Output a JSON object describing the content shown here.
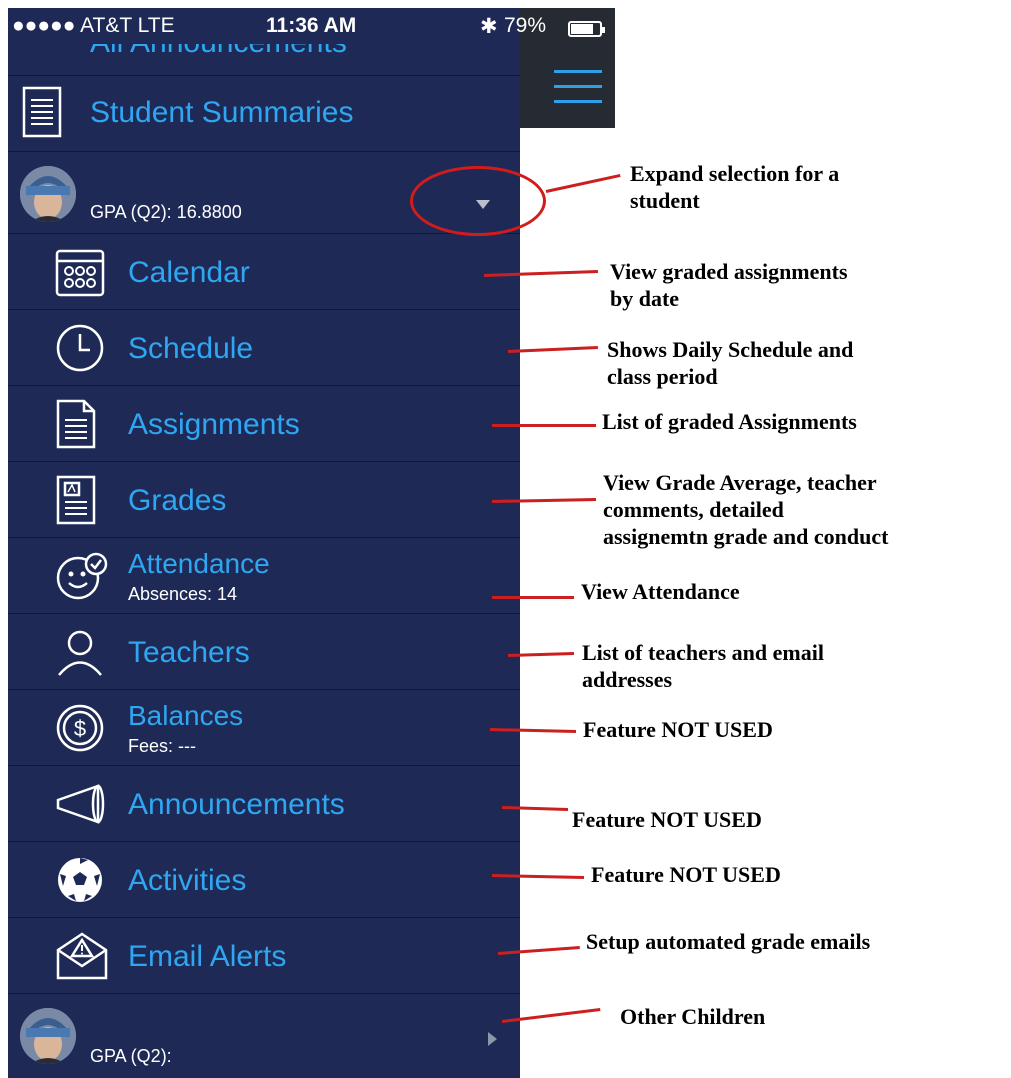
{
  "status_bar": {
    "carrier": "●●●●● AT&T  LTE",
    "time": "11:36 AM",
    "bluetooth": "✱",
    "battery": "79%",
    "battery_level": 0.79
  },
  "top_items": {
    "partial_label": "All Announcements",
    "student_summaries": "Student Summaries"
  },
  "student": {
    "gpa": "GPA (Q2): 16.8800"
  },
  "menu_items": [
    {
      "label": "Calendar",
      "icon": "calendar-icon"
    },
    {
      "label": "Schedule",
      "icon": "clock-icon"
    },
    {
      "label": "Assignments",
      "icon": "document-icon"
    },
    {
      "label": "Grades",
      "icon": "grades-document-icon"
    },
    {
      "label": "Attendance",
      "sub": "Absences: 14",
      "icon": "smiley-check-icon"
    },
    {
      "label": "Teachers",
      "icon": "person-icon"
    },
    {
      "label": "Balances",
      "sub": "Fees: ---",
      "icon": "dollar-coin-icon"
    },
    {
      "label": "Announcements",
      "icon": "megaphone-icon"
    },
    {
      "label": "Activities",
      "icon": "soccer-ball-icon"
    },
    {
      "label": "Email Alerts",
      "icon": "envelope-alert-icon"
    }
  ],
  "other_student": {
    "gpa": "GPA (Q2):"
  },
  "annotations": {
    "expand": "Expand selection for a\nstudent",
    "calendar": "View graded assignments\nby date",
    "schedule": "Shows Daily Schedule and\nclass period",
    "assignments": "List of graded Assignments",
    "grades": "View Grade Average, teacher\ncomments, detailed\nassignemtn grade and conduct",
    "attendance": "View Attendance",
    "teachers": "List of teachers and email\naddresses",
    "balances": "Feature NOT USED",
    "announcements": "Feature NOT USED",
    "activities": "Feature NOT USED",
    "email_alerts": "Setup automated grade emails",
    "other_children": "Other Children"
  },
  "colors": {
    "menu_bg": "#1e2a55",
    "accent": "#2fa6f2",
    "annotation_line": "#cc1f1f"
  }
}
